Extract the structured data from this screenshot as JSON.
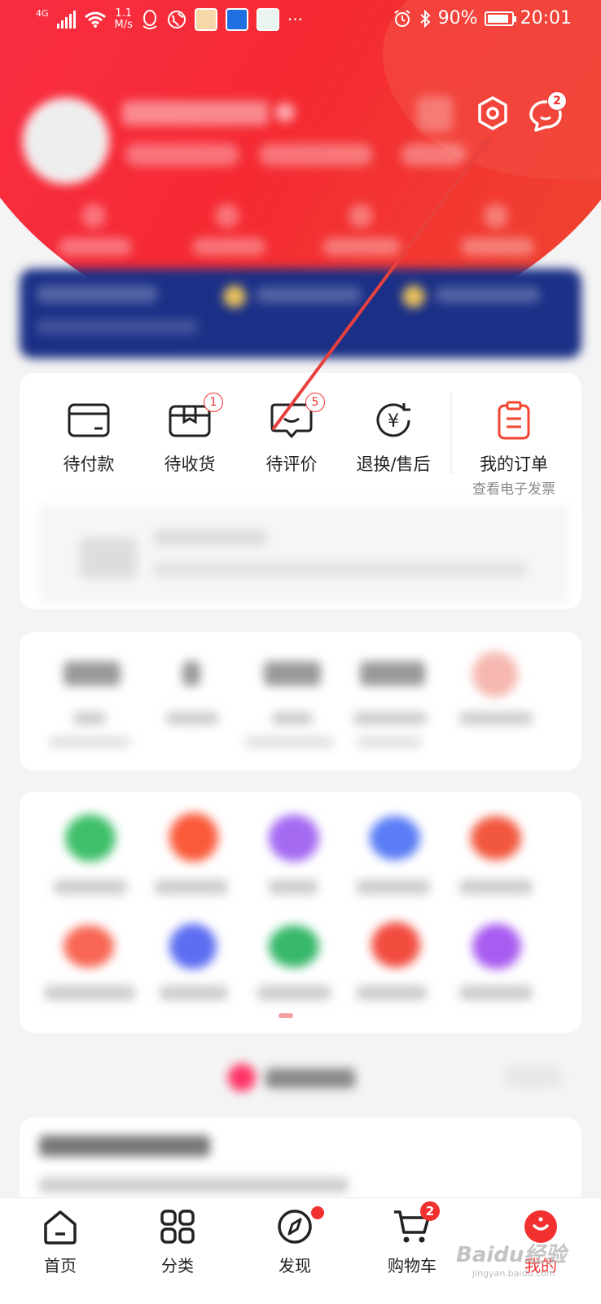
{
  "status_bar": {
    "network": "4G",
    "speed_value": "1.1",
    "speed_unit": "M/s",
    "more": "···",
    "battery": "90%",
    "battery_level": 0.9,
    "time": "20:01"
  },
  "header": {
    "messages_badge": "2"
  },
  "orders": {
    "items": [
      {
        "label": "待付款",
        "badge": ""
      },
      {
        "label": "待收货",
        "badge": "1"
      },
      {
        "label": "待评价",
        "badge": "5"
      },
      {
        "label": "退换/售后",
        "badge": ""
      }
    ],
    "my_orders_label": "我的订单",
    "invoice_label": "查看电子发票"
  },
  "tabbar": {
    "items": [
      {
        "label": "首页",
        "icon": "home-icon"
      },
      {
        "label": "分类",
        "icon": "grid-icon"
      },
      {
        "label": "发现",
        "icon": "compass-icon"
      },
      {
        "label": "购物车",
        "icon": "cart-icon",
        "badge": "2"
      },
      {
        "label": "我的",
        "icon": "profile-icon"
      }
    ]
  },
  "watermark": {
    "text": "Baidu经验",
    "sub": "jingyan.baidu.com"
  },
  "colors": {
    "accent": "#f23030",
    "banner": "#1b2f86"
  }
}
